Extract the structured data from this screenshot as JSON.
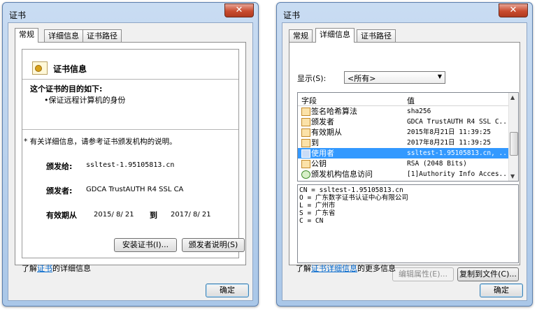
{
  "left_window": {
    "title": "证书",
    "close_glyph": "✕",
    "tabs": [
      "常规",
      "详细信息",
      "证书路径"
    ],
    "cert_heading": "证书信息",
    "purpose_heading": "这个证书的目的如下:",
    "purpose_items": [
      "•保证远程计算机的身份"
    ],
    "footnote": "* 有关详细信息，请参考证书颁发机构的说明。",
    "issued_to_label": "颁发给:",
    "issued_to_value": "ssltest-1.95105813.cn",
    "issued_by_label": "颁发者:",
    "issued_by_value": "GDCA TrustAUTH R4 SSL CA",
    "validity_label": "有效期从",
    "valid_from": "2015/ 8/ 21",
    "validity_to_label": "到",
    "valid_to": "2017/ 8/ 21",
    "install_button": "安装证书(I)...",
    "issuer_statement_button": "颁发者说明(S)",
    "learn_prefix": "了解",
    "learn_link": "证书",
    "learn_suffix": "的详细信息",
    "ok_button": "确定"
  },
  "right_window": {
    "title": "证书",
    "close_glyph": "✕",
    "tabs": [
      "常规",
      "详细信息",
      "证书路径"
    ],
    "show_label": "显示(S):",
    "show_value": "<所有>",
    "dropdown_arrow": "▼",
    "columns": [
      "字段",
      "值"
    ],
    "rows": [
      {
        "field": "签名哈希算法",
        "value": "sha256"
      },
      {
        "field": "颁发者",
        "value": "GDCA TrustAUTH R4 SSL C..."
      },
      {
        "field": "有效期从",
        "value": "2015年8月21日 11:39:25"
      },
      {
        "field": "到",
        "value": "2017年8月21日 11:39:25"
      },
      {
        "field": "使用者",
        "value": "ssltest-1.95105813.cn, ..."
      },
      {
        "field": "公钥",
        "value": "RSA (2048 Bits)"
      },
      {
        "field": "颁发机构信息访问",
        "value": "[1]Authority Info Acces..."
      }
    ],
    "selected_row_index": 4,
    "detail_lines": [
      "CN = ssltest-1.95105813.cn",
      "O = 广东数字证书认证中心有限公司",
      "L = 广州市",
      "S = 广东省",
      "C = CN"
    ],
    "edit_properties_button": "编辑属性(E)...",
    "copy_to_file_button": "复制到文件(C)...",
    "learn_prefix": "了解",
    "learn_link": "证书详细信息",
    "learn_suffix": "的更多信息",
    "ok_button": "确定"
  }
}
